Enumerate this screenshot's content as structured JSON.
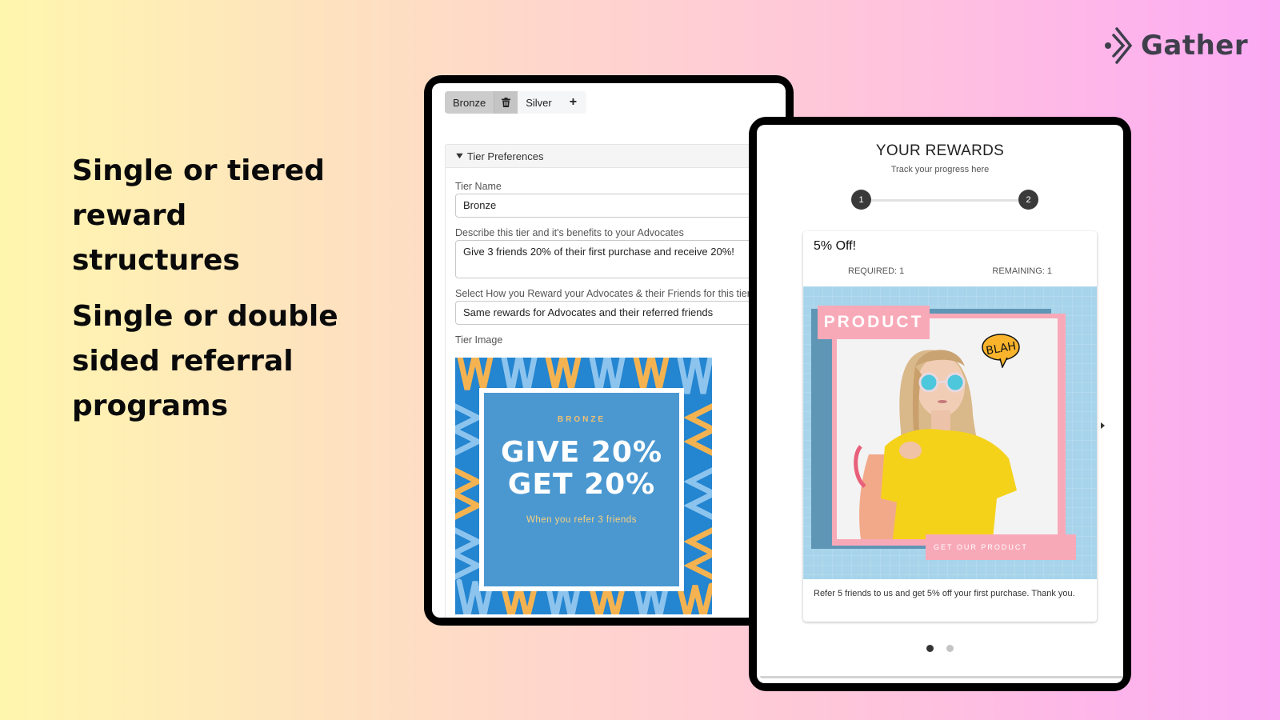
{
  "brand": {
    "name": "Gather",
    "icon": "gather-logo-icon",
    "text_color": "#3f3f4c"
  },
  "headlines": [
    "Single  or tiered reward structures",
    "Single or double sided referral programs"
  ],
  "tier_editor": {
    "tabs": [
      {
        "label": "Bronze",
        "active": true
      },
      {
        "icon": "trash-icon"
      },
      {
        "label": "Silver",
        "active": false
      },
      {
        "icon": "plus-icon",
        "label": "+"
      }
    ],
    "section": {
      "title": "Tier Preferences",
      "icon": "chevron-down-icon"
    },
    "fields": {
      "tier_name": {
        "label": "Tier Name",
        "value": "Bronze"
      },
      "description": {
        "label": "Describe this tier and it's benefits to your Advocates",
        "value": "Give 3 friends 20% of their first purchase and receive 20%!"
      },
      "reward_type": {
        "label": "Select How you Reward your Advocates & their Friends for this tier",
        "value": "Same rewards for Advocates and their referred friends"
      },
      "tier_image": {
        "label": "Tier Image"
      }
    },
    "tier_image_card": {
      "kicker": "BRONZE",
      "line1": "GIVE 20%",
      "line2": "GET 20%",
      "sub": "When you refer 3 friends",
      "colors": {
        "background": "#2485d0",
        "card": "#4b98d1",
        "accent": "#f4b350",
        "light": "#8cc4ee"
      }
    }
  },
  "rewards": {
    "title": "YOUR REWARDS",
    "subtitle": "Track your progress here",
    "steps": [
      "1",
      "2"
    ],
    "card": {
      "title": "5% Off!",
      "required": "REQUIRED: 1",
      "remaining": "REMAINING: 1",
      "promo": {
        "tag": "PRODUCT",
        "speech": "BLAH",
        "cta": "GET OUR PRODUCT",
        "colors": {
          "bg": "#a7d4ea",
          "pink": "#f8a9b8",
          "shadow": "#5f95b5"
        }
      },
      "description": "Refer 5 friends to us and get 5% off your first purchase. Thank you."
    },
    "pagination": {
      "count": 2,
      "active": 0
    }
  }
}
